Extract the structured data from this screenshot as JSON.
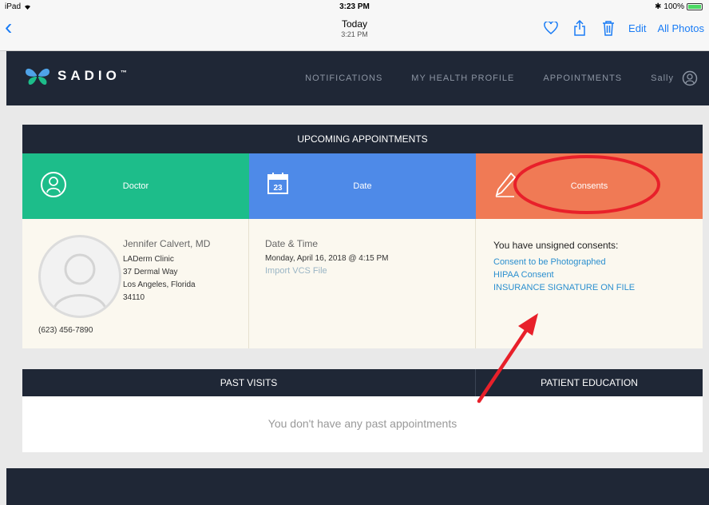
{
  "status_bar": {
    "device": "iPad",
    "time": "3:23 PM",
    "battery": "100%"
  },
  "photos_toolbar": {
    "title": "Today",
    "subtitle": "3:21 PM",
    "edit_label": "Edit",
    "all_photos_label": "All Photos",
    "icons": [
      "back-chevron-icon",
      "heart-icon",
      "share-icon",
      "trash-icon"
    ]
  },
  "header": {
    "logo_text": "SADIO",
    "trademark": "™",
    "nav": [
      "NOTIFICATIONS",
      "MY HEALTH PROFILE",
      "APPOINTMENTS"
    ],
    "user_name": "Sally"
  },
  "upcoming": {
    "title": "UPCOMING APPOINTMENTS",
    "tiles": {
      "doctor": "Doctor",
      "date": "Date",
      "calendar_day": "23",
      "consents": "Consents"
    },
    "doctor": {
      "name": "Jennifer Calvert, MD",
      "clinic": "LADerm Clinic",
      "street": "37 Dermal Way",
      "city": "Los Angeles, Florida",
      "zip": "34110",
      "phone": "(623) 456-7890"
    },
    "datetime": {
      "label": "Date & Time",
      "value": "Monday, April 16, 2018 @ 4:15 PM",
      "import_link": "Import VCS File"
    },
    "consents": {
      "title": "You have unsigned consents:",
      "items": [
        "Consent to be Photographed",
        "HIPAA Consent",
        "INSURANCE SIGNATURE ON FILE"
      ]
    }
  },
  "past_visits": {
    "title": "PAST VISITS",
    "education_title": "PATIENT EDUCATION",
    "empty_message": "You don't have any past appointments"
  },
  "colors": {
    "navy": "#1f2736",
    "doctor_tile": "#1dbd8a",
    "date_tile": "#4e8ae8",
    "consent_tile": "#f07a55",
    "link": "#2b8fcf",
    "annotation": "#e8202a"
  }
}
